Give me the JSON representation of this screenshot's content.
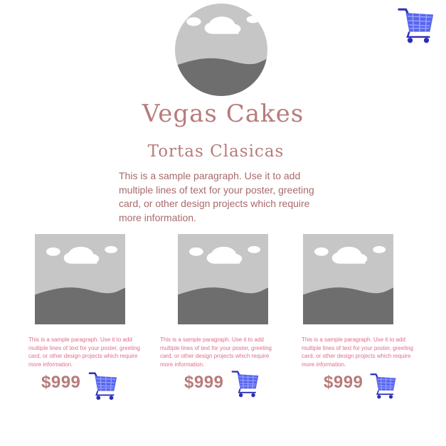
{
  "header": {
    "brand": "Vegas Cakes",
    "cart_icon": "shopping-cart-icon",
    "logo_icon": "image-placeholder-icon"
  },
  "section": {
    "title": "Tortas Clasicas",
    "intro": "This is a sample paragraph. Use it to add multiple lines of text for your poster, greeting card, or other design projects which require more information."
  },
  "products": [
    {
      "image_icon": "image-placeholder-icon",
      "description": "This is a sample paragraph. Use it to add multiple lines of text for your poster, greeting card, or other design projects which require more information.",
      "price": "$999",
      "cart_icon": "shopping-cart-icon"
    },
    {
      "image_icon": "image-placeholder-icon",
      "description": "This is a sample paragraph. Use it to add multiple lines of text for your poster, greeting card, or other design projects which require more information.",
      "price": "$999",
      "cart_icon": "shopping-cart-icon"
    },
    {
      "image_icon": "image-placeholder-icon",
      "description": "This is a sample paragraph. Use it to add multiple lines of text for your poster, greeting card, or other design projects which require more information.",
      "price": "$999",
      "cart_icon": "shopping-cart-icon"
    }
  ],
  "colors": {
    "accent": "#b87b7b",
    "card_text": "#e06c8c",
    "cart": "#4a5be8"
  }
}
